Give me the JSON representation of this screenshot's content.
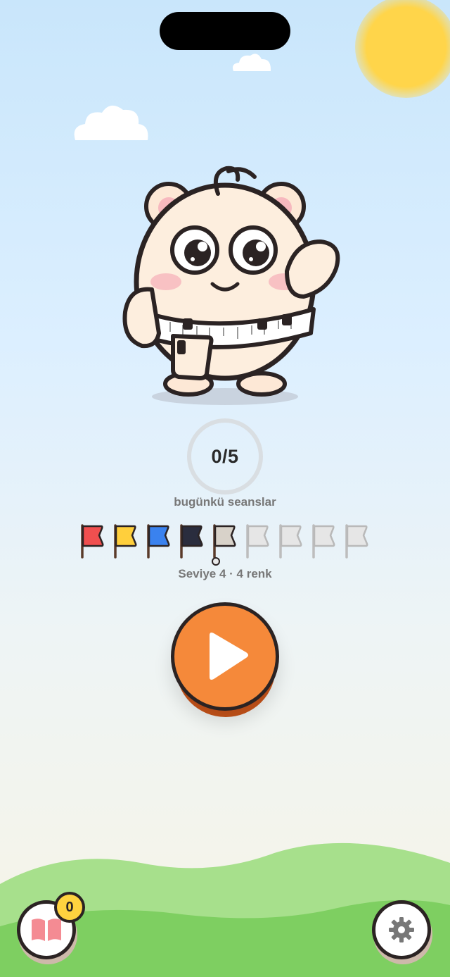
{
  "progress": {
    "completed": 0,
    "total": 5,
    "text": "0/5",
    "label": "bugünkü seanslar"
  },
  "level": {
    "text": "Seviye 4 · 4 renk",
    "flags": [
      {
        "color": "#f04f4f",
        "unlocked": true
      },
      {
        "color": "#ffcf3c",
        "unlocked": true
      },
      {
        "color": "#3a82ef",
        "unlocked": true
      },
      {
        "color": "#2a2d3e",
        "unlocked": true
      },
      {
        "color": "#d8d2c9",
        "unlocked": false,
        "current": true
      },
      {
        "color": "#e6e6e6",
        "unlocked": false
      },
      {
        "color": "#e6e6e6",
        "unlocked": false
      },
      {
        "color": "#e6e6e6",
        "unlocked": false
      },
      {
        "color": "#e6e6e6",
        "unlocked": false
      }
    ]
  },
  "play": {
    "icon": "play-icon",
    "color": "#f5893a"
  },
  "journal": {
    "icon": "book-icon",
    "badge_count": "0"
  },
  "settings": {
    "icon": "gear-icon"
  },
  "colors": {
    "accent": "#f5893a",
    "outline": "#2b2323",
    "grass": "#7ecf61",
    "sun": "#ffd54a"
  }
}
